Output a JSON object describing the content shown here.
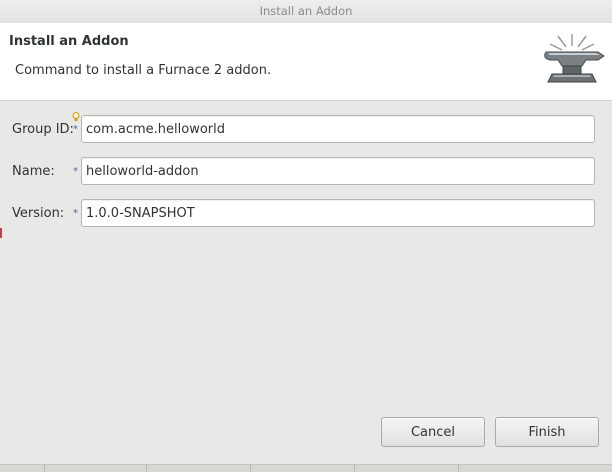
{
  "window": {
    "title": "Install an Addon"
  },
  "banner": {
    "title": "Install an Addon",
    "description": "Command to install a Furnace 2 addon.",
    "icon": "anvil-icon"
  },
  "form": {
    "group_id": {
      "label": "Group ID:",
      "value": "com.acme.helloworld",
      "required": true
    },
    "name": {
      "label": "Name:",
      "value": "helloworld-addon",
      "required": true
    },
    "version": {
      "label": "Version:",
      "value": "1.0.0-SNAPSHOT",
      "required": true
    },
    "required_marker": "*",
    "hint_icon": "lightbulb-icon"
  },
  "buttons": {
    "cancel": "Cancel",
    "finish": "Finish"
  },
  "colors": {
    "background": "#e8e8e7",
    "banner_bg": "#ffffff",
    "text": "#2e3436",
    "title_text": "#8a8d88"
  }
}
